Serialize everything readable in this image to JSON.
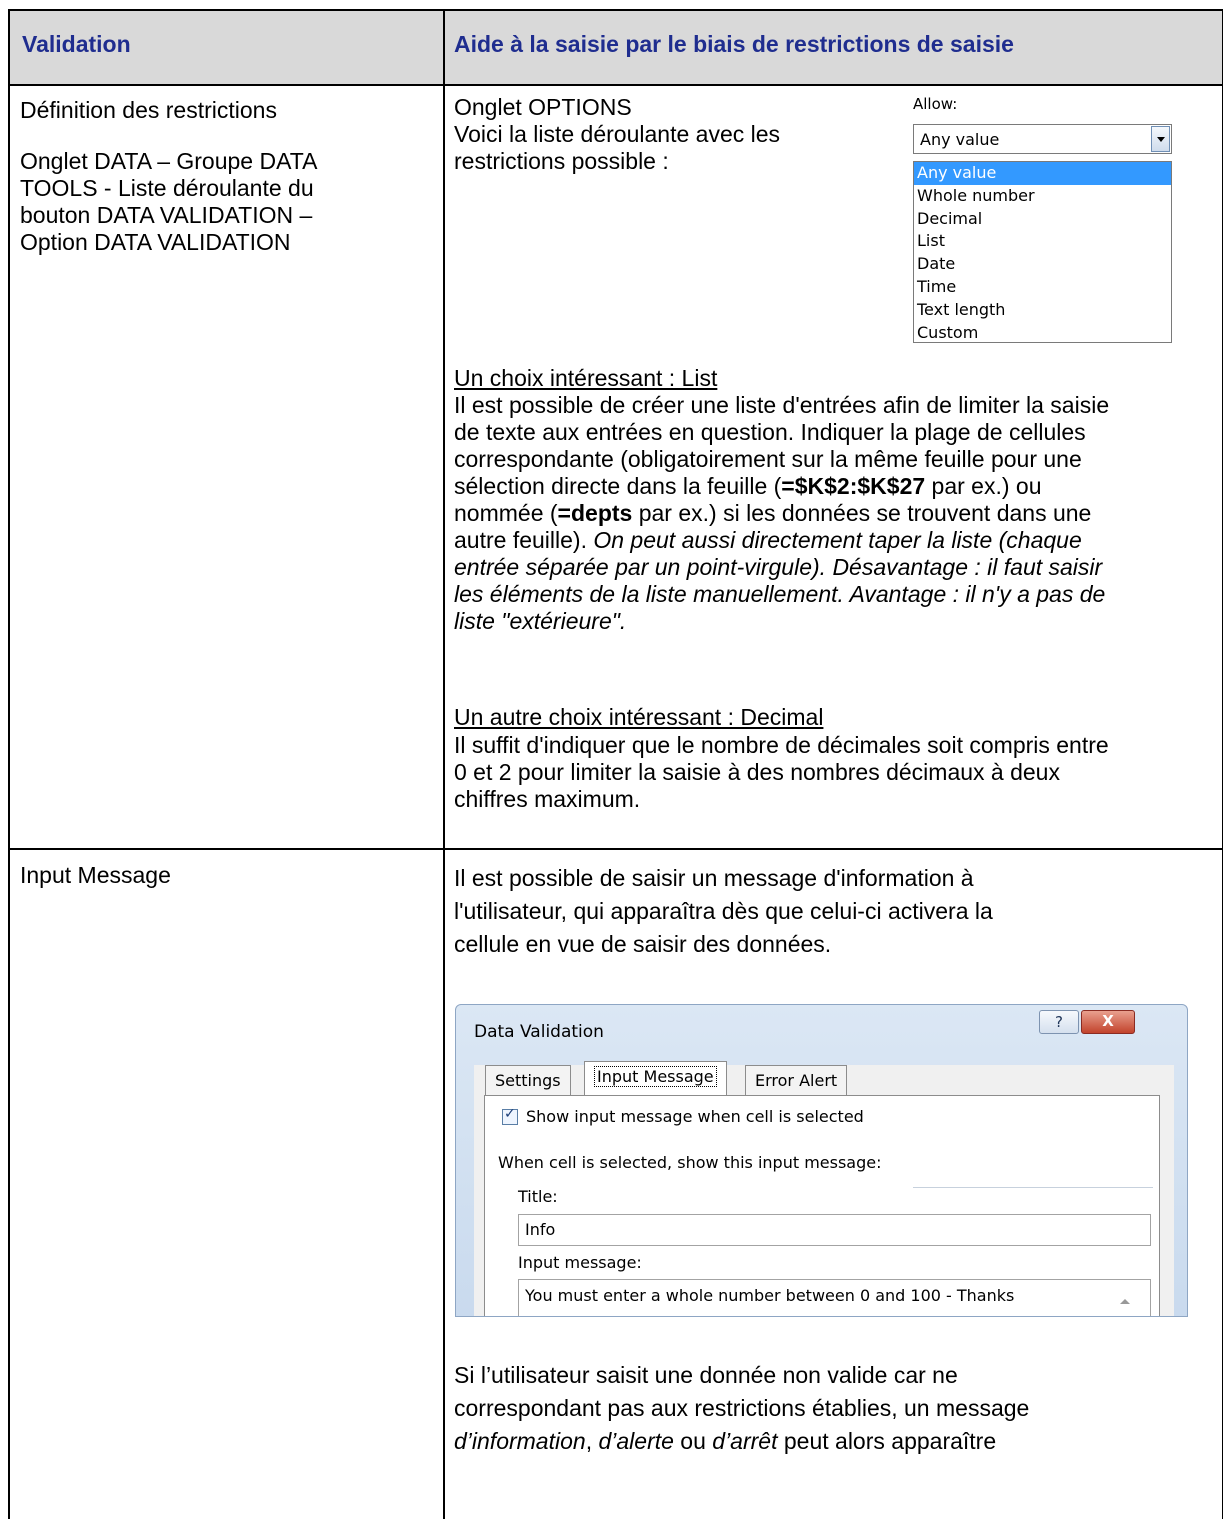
{
  "header": {
    "col1": "Validation",
    "col2": "Aide à la saisie par le biais de restrictions de saisie"
  },
  "row1": {
    "left_title": "Définition des restrictions",
    "left_path": [
      "Onglet DATA – Groupe DATA",
      "TOOLS - Liste déroulante du",
      "bouton DATA VALIDATION –",
      "Option DATA VALIDATION"
    ],
    "right_intro": [
      "Onglet OPTIONS",
      "Voici la liste déroulante avec les",
      "restrictions possible :"
    ],
    "dropdown": {
      "label": "Allow:",
      "value": "Any value",
      "options": [
        "Any value",
        "Whole number",
        "Decimal",
        "List",
        "Date",
        "Time",
        "Text length",
        "Custom"
      ],
      "selected": "Any value"
    },
    "list_heading": "Un choix intéressant : List",
    "list_text": {
      "l1": "Il est possible de créer une liste d'entrées afin de limiter la saisie",
      "l2": "de texte aux entrées en question. Indiquer la plage de cellules",
      "l3": "correspondante (obligatoirement sur la même feuille pour une",
      "l4a": "sélection directe dans la feuille (",
      "l4b": "=$K$2:$K$27",
      "l4c": " par ex.) ou",
      "l5a": "nommée (",
      "l5b": "=depts",
      "l5c": " par ex.) si les données se trouvent dans une",
      "l6a": "autre feuille). ",
      "l6b": "On peut aussi directement taper la liste (chaque",
      "l7": "entrée séparée par un point-virgule). Désavantage : il faut saisir",
      "l8": "les éléments de la liste manuellement. Avantage : il n'y a pas de",
      "l9": "liste \"extérieure\"."
    },
    "decimal_heading": "Un autre choix intéressant : Decimal",
    "decimal_text": [
      "Il suffit d'indiquer que le nombre de décimales soit compris entre",
      "0 et 2 pour limiter la saisie à des nombres décimaux à deux",
      "chiffres maximum."
    ]
  },
  "row2": {
    "left_title": "Input Message",
    "intro": [
      "Il est possible de saisir un message d'information à",
      "l'utilisateur, qui apparaîtra dès que celui-ci activera la",
      "cellule en vue de saisir des données."
    ],
    "dialog": {
      "title": "Data Validation",
      "help": "?",
      "close": "X",
      "tabs": [
        "Settings",
        "Input Message",
        "Error Alert"
      ],
      "checkbox_label": "Show input message when cell is selected",
      "group_label": "When cell is selected, show this input message:",
      "title_label": "Title:",
      "title_value": "Info",
      "message_label": "Input message:",
      "message_value": "You must enter a whole number between 0 and 100 - Thanks"
    },
    "outro": {
      "l1": "Si l’utilisateur saisit une donnée non valide car ne",
      "l2": "correspondant pas aux restrictions établies, un message",
      "l3a": "d’information",
      "l3b": ", ",
      "l3c": "d’alerte",
      "l3d": " ou ",
      "l3e": "d’arrêt",
      "l3f": " peut alors apparaître"
    }
  }
}
